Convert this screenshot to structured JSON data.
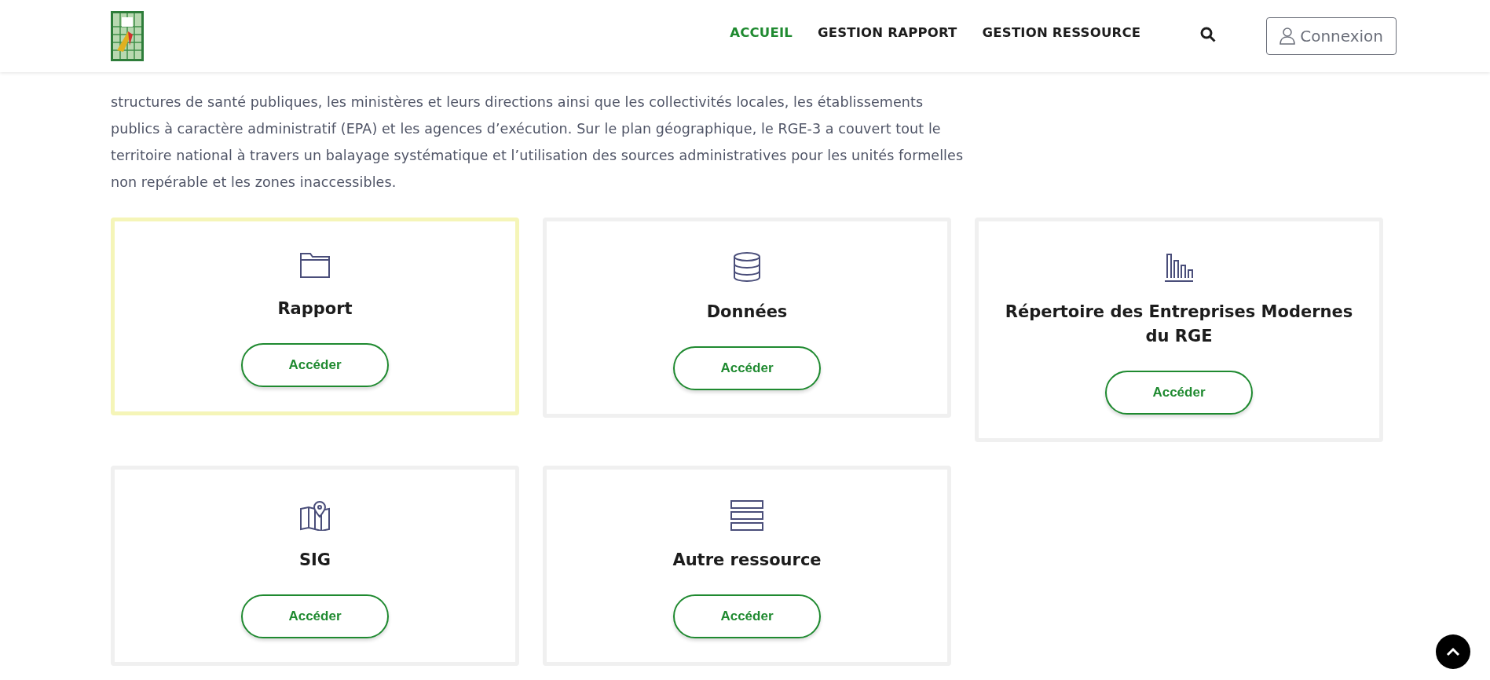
{
  "header": {
    "nav": [
      {
        "label": "ACCUEIL",
        "selected": true
      },
      {
        "label": "GESTION RAPPORT",
        "selected": false
      },
      {
        "label": "GESTION RESSOURCE",
        "selected": false
      }
    ],
    "login_button": "Connexion"
  },
  "intro": "structures de santé publiques, les ministères et leurs directions ainsi que les collectivités locales, les établissements\npublics à caractère administratif (EPA) et les agences d’exécution. Sur le plan géographique, le RGE-3 a couvert tout le\nterritoire national à travers un balayage systématique et l’utilisation des sources administratives pour les unités formelles\nnon repérable et les zones inaccessibles.",
  "cards": [
    {
      "kind": "folder",
      "title": "Rapport",
      "button": "Accéder",
      "highlighted": true
    },
    {
      "kind": "database",
      "title": "Données",
      "button": "Accéder",
      "highlighted": false
    },
    {
      "kind": "bars",
      "title": "Répertoire des Entreprises Modernes du RGE",
      "button": "Accéder",
      "highlighted": false
    },
    {
      "kind": "map",
      "title": "SIG",
      "button": "Accéder",
      "highlighted": false
    },
    {
      "kind": "stack",
      "title": "Autre ressource",
      "button": "Accéder",
      "highlighted": false
    }
  ]
}
